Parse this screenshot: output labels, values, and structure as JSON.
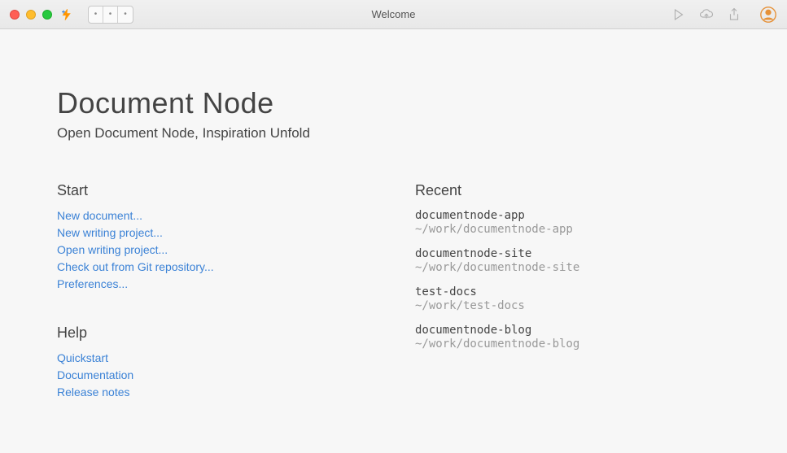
{
  "window": {
    "title": "Welcome"
  },
  "header": {
    "app_title": "Document Node",
    "app_subtitle": "Open Document Node, Inspiration Unfold"
  },
  "sections": {
    "start_title": "Start",
    "help_title": "Help",
    "recent_title": "Recent"
  },
  "start_links": [
    {
      "label": "New document..."
    },
    {
      "label": "New writing project..."
    },
    {
      "label": "Open writing project..."
    },
    {
      "label": "Check out from Git repository..."
    },
    {
      "label": "Preferences..."
    }
  ],
  "help_links": [
    {
      "label": "Quickstart"
    },
    {
      "label": "Documentation"
    },
    {
      "label": "Release notes"
    }
  ],
  "recent_items": [
    {
      "name": "documentnode-app",
      "path": "~/work/documentnode-app"
    },
    {
      "name": "documentnode-site",
      "path": "~/work/documentnode-site"
    },
    {
      "name": "test-docs",
      "path": "~/work/test-docs"
    },
    {
      "name": "documentnode-blog",
      "path": "~/work/documentnode-blog"
    }
  ]
}
